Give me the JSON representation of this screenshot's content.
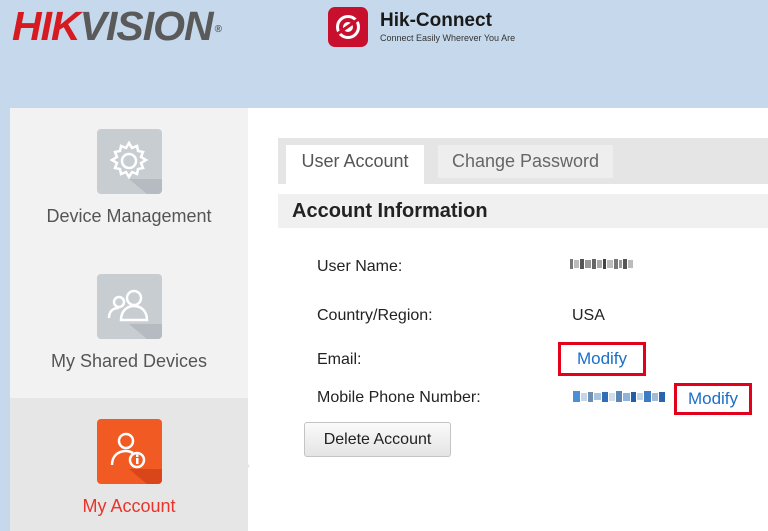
{
  "header": {
    "brand_red": "HIK",
    "brand_gray": "VISION",
    "brand_mark": "®",
    "app_name": "Hik-Connect",
    "app_tagline": "Connect Easily Wherever You Are"
  },
  "sidebar": {
    "items": [
      {
        "label": "Device Management",
        "icon": "gear-icon",
        "active": false
      },
      {
        "label": "My Shared Devices",
        "icon": "users-icon",
        "active": false
      },
      {
        "label": "My Account",
        "icon": "user-info-icon",
        "active": true
      }
    ]
  },
  "tabs": [
    {
      "label": "User Account",
      "active": true
    },
    {
      "label": "Change Password",
      "active": false
    }
  ],
  "section": {
    "title": "Account Information"
  },
  "fields": {
    "username_label": "User Name:",
    "country_label": "Country/Region:",
    "country_value": "USA",
    "email_label": "Email:",
    "email_link": "Modify",
    "phone_label": "Mobile Phone Number:",
    "phone_link": "Modify"
  },
  "actions": {
    "delete_label": "Delete Account"
  },
  "colors": {
    "brand_red": "#d71920",
    "accent_orange": "#f15a22",
    "link_blue": "#1a6fc9",
    "highlight_red": "#e3001b"
  }
}
